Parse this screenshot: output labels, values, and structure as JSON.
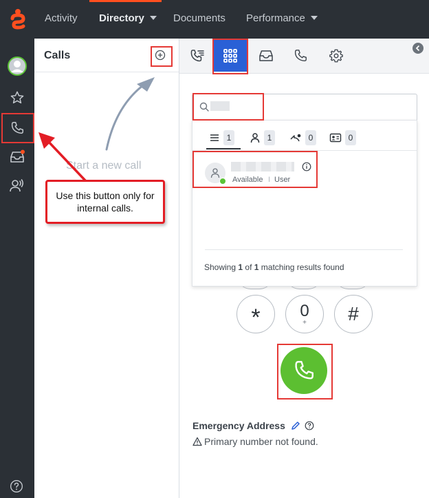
{
  "topnav": {
    "items": [
      {
        "label": "Activity",
        "has_dropdown": false,
        "active": false
      },
      {
        "label": "Directory",
        "has_dropdown": true,
        "active": true
      },
      {
        "label": "Documents",
        "has_dropdown": false,
        "active": false
      },
      {
        "label": "Performance",
        "has_dropdown": true,
        "active": false
      }
    ],
    "accent_color": "#ff4f1f"
  },
  "leftnav": {
    "items": [
      {
        "icon": "avatar-icon"
      },
      {
        "icon": "star-icon"
      },
      {
        "icon": "phone-icon",
        "active": true
      },
      {
        "icon": "inbox-icon",
        "has_notification": true
      },
      {
        "icon": "voice-user-icon"
      }
    ],
    "help_icon": "help-icon"
  },
  "calls": {
    "title": "Calls",
    "start_text": "Start a new call",
    "add_icon": "plus-circle-icon"
  },
  "tabs": [
    {
      "icon": "call-list-icon",
      "active": false
    },
    {
      "icon": "dialpad-icon",
      "active": true
    },
    {
      "icon": "inbox-icon",
      "active": false
    },
    {
      "icon": "phone-icon",
      "active": false
    },
    {
      "icon": "gear-icon",
      "active": false
    }
  ],
  "search": {
    "placeholder": "",
    "icon": "search-icon"
  },
  "filters": [
    {
      "icon": "list-icon",
      "count": "1"
    },
    {
      "icon": "user-icon",
      "count": "1"
    },
    {
      "icon": "group-icon",
      "count": "0"
    },
    {
      "icon": "contact-card-icon",
      "count": "0"
    }
  ],
  "result": {
    "status": "Available",
    "separator": "I",
    "role": "User",
    "presence_color": "#5bc236"
  },
  "showing": {
    "prefix": "Showing ",
    "shown": "1",
    "of": " of ",
    "total": "1",
    "suffix": " matching results found"
  },
  "dialpad": {
    "keys": [
      {
        "main": "*",
        "sub": ""
      },
      {
        "main": "0",
        "sub": "+"
      },
      {
        "main": "#",
        "sub": ""
      }
    ],
    "call_color": "#5cbf31"
  },
  "emergency": {
    "title": "Emergency Address",
    "message": "Primary number not found."
  },
  "annotation": {
    "callout_text": "Use this button only for internal calls."
  }
}
